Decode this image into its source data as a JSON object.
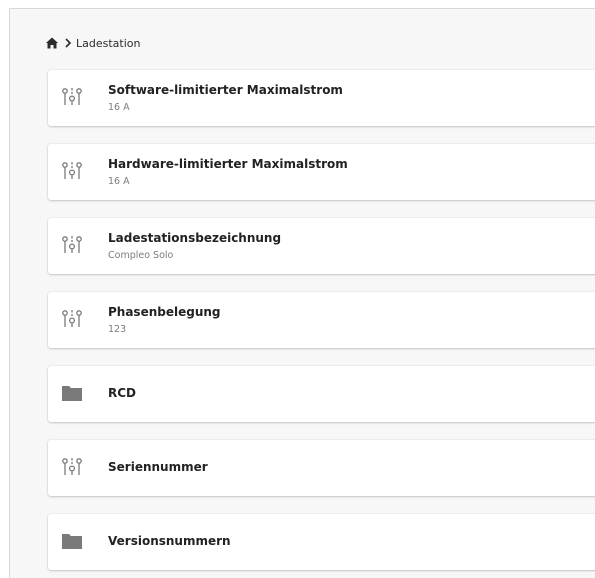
{
  "breadcrumb": {
    "home_icon": "home-icon",
    "separator_icon": "chevron-right-icon",
    "current": "Ladestation"
  },
  "items": [
    {
      "icon": "sliders-icon",
      "title": "Software-limitierter Maximalstrom",
      "value": "16 A"
    },
    {
      "icon": "sliders-icon",
      "title": "Hardware-limitierter Maximalstrom",
      "value": "16 A"
    },
    {
      "icon": "sliders-icon",
      "title": "Ladestationsbezeichnung",
      "value": "Compleo Solo"
    },
    {
      "icon": "sliders-icon",
      "title": "Phasenbelegung",
      "value": "123"
    },
    {
      "icon": "folder-icon",
      "title": "RCD"
    },
    {
      "icon": "sliders-icon",
      "title": "Seriennummer"
    },
    {
      "icon": "folder-icon",
      "title": "Versionsnummern"
    }
  ],
  "colors": {
    "icon": "#7a7a7a",
    "background": "#f7f7f7",
    "card": "#ffffff"
  }
}
